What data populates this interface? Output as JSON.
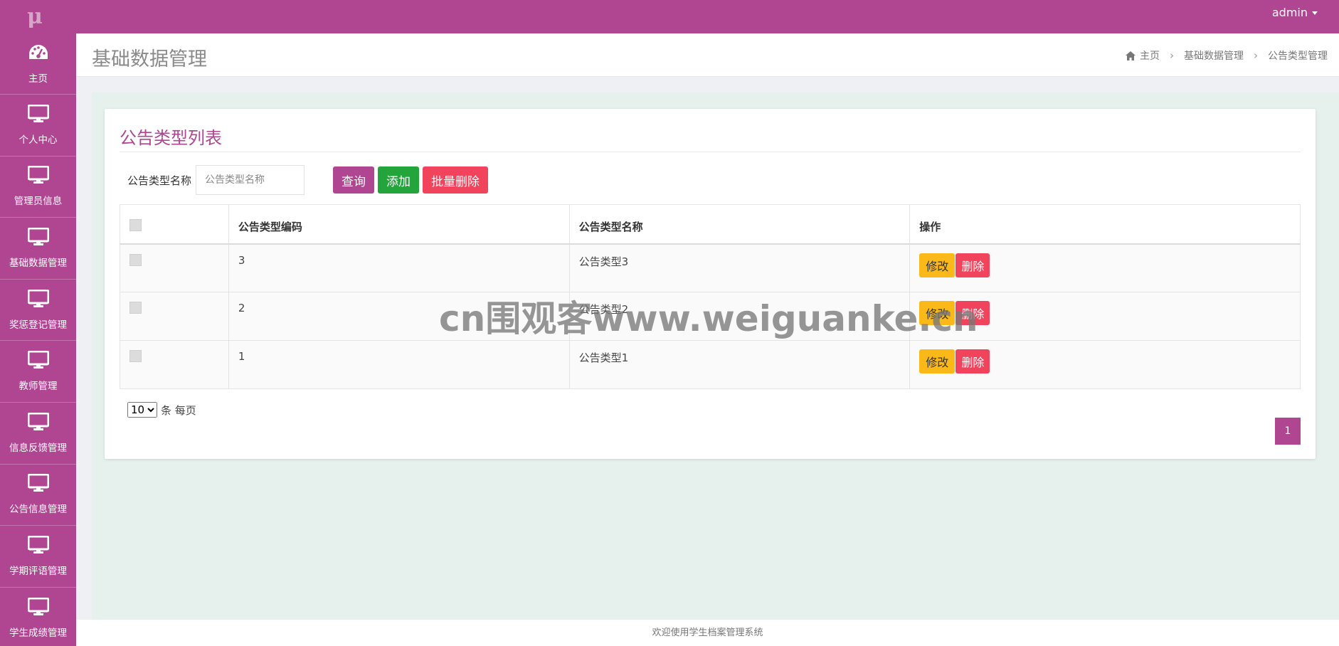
{
  "app": {
    "logo": "μ",
    "user": "admin"
  },
  "sidebar": {
    "items": [
      {
        "label": "主页",
        "icon": "dashboard-icon"
      },
      {
        "label": "个人中心",
        "icon": "monitor-icon"
      },
      {
        "label": "管理员信息",
        "icon": "monitor-icon"
      },
      {
        "label": "基础数据管理",
        "icon": "monitor-icon"
      },
      {
        "label": "奖惩登记管理",
        "icon": "monitor-icon"
      },
      {
        "label": "教师管理",
        "icon": "monitor-icon"
      },
      {
        "label": "信息反馈管理",
        "icon": "monitor-icon"
      },
      {
        "label": "公告信息管理",
        "icon": "monitor-icon"
      },
      {
        "label": "学期评语管理",
        "icon": "monitor-icon"
      },
      {
        "label": "学生成绩管理",
        "icon": "monitor-icon"
      }
    ]
  },
  "header": {
    "title": "基础数据管理",
    "breadcrumb": [
      "主页",
      "基础数据管理",
      "公告类型管理"
    ]
  },
  "panel": {
    "title": "公告类型列表",
    "search": {
      "label": "公告类型名称",
      "placeholder": "公告类型名称",
      "value": ""
    },
    "buttons": {
      "query": "查询",
      "add": "添加",
      "batch_delete": "批量删除"
    },
    "table": {
      "columns": [
        "公告类型编码",
        "公告类型名称",
        "操作"
      ],
      "rows": [
        {
          "code": "3",
          "name": "公告类型3"
        },
        {
          "code": "2",
          "name": "公告类型2"
        },
        {
          "code": "1",
          "name": "公告类型1"
        }
      ],
      "edit_label": "修改",
      "delete_label": "删除"
    },
    "pager": {
      "page_size": "10",
      "suffix": "条 每页",
      "current_page": "1"
    }
  },
  "watermark": "cn围观客www.weiguanke.cn",
  "footer": "欢迎使用学生档案管理系统",
  "colors": {
    "brand": "#b04592",
    "add": "#23a53c",
    "danger": "#f1435b",
    "edit": "#fbb819",
    "content_bg": "#e6f1ee"
  }
}
